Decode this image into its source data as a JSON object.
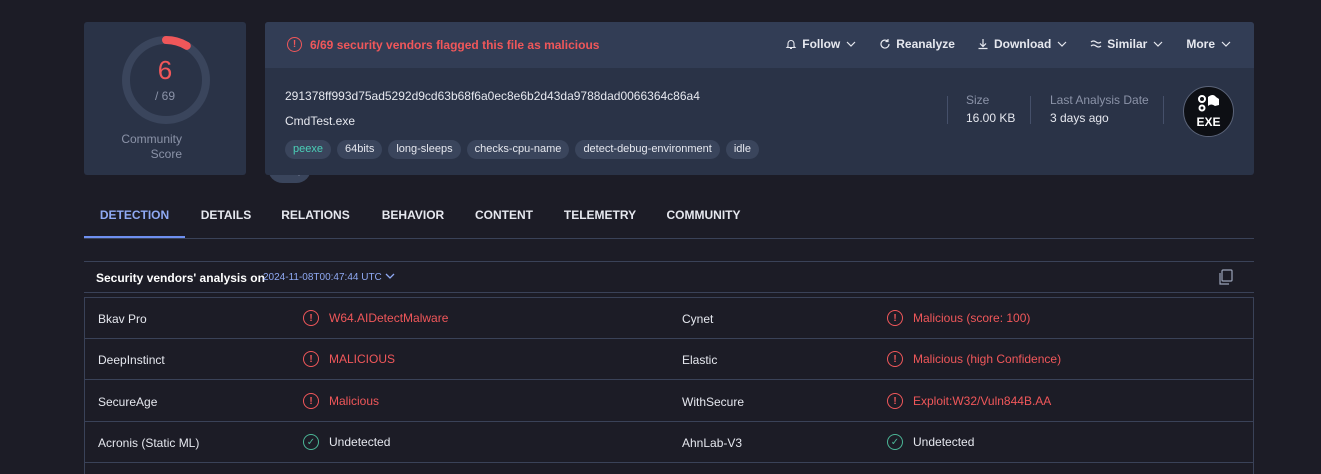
{
  "score": {
    "detected": "6",
    "total": "/ 69",
    "community_label_1": "Community",
    "community_label_2": "Score",
    "ring_color": "#f0575a",
    "detected_fraction": 0.087
  },
  "header": {
    "alert_text": "6/69 security vendors flagged this file as malicious",
    "actions": {
      "follow": "Follow",
      "reanalyze": "Reanalyze",
      "download": "Download",
      "similar": "Similar",
      "more": "More"
    }
  },
  "file": {
    "hash": "291378ff993d75ad5292d9cd63b68f6a0ec8e6b2d43da9788dad0066364c86a4",
    "name": "CmdTest.exe",
    "tags": [
      "peexe",
      "64bits",
      "long-sleeps",
      "checks-cpu-name",
      "detect-debug-environment",
      "idle"
    ],
    "size_label": "Size",
    "size_value": "16.00 KB",
    "last_analysis_label": "Last Analysis Date",
    "last_analysis_value": "3 days ago",
    "type_badge": "EXE"
  },
  "tabs": [
    "DETECTION",
    "DETAILS",
    "RELATIONS",
    "BEHAVIOR",
    "CONTENT",
    "TELEMETRY",
    "COMMUNITY"
  ],
  "analysis": {
    "title": "Security vendors' analysis on",
    "date": "2024-11-08T00:47:44 UTC"
  },
  "vendors": [
    {
      "left_name": "Bkav Pro",
      "left_result": "W64.AIDetectMalware",
      "left_status": "malicious",
      "right_name": "Cynet",
      "right_result": "Malicious (score: 100)",
      "right_status": "malicious"
    },
    {
      "left_name": "DeepInstinct",
      "left_result": "MALICIOUS",
      "left_status": "malicious",
      "right_name": "Elastic",
      "right_result": "Malicious (high Confidence)",
      "right_status": "malicious"
    },
    {
      "left_name": "SecureAge",
      "left_result": "Malicious",
      "left_status": "malicious",
      "right_name": "WithSecure",
      "right_result": "Exploit:W32/Vuln844B.AA",
      "right_status": "malicious"
    },
    {
      "left_name": "Acronis (Static ML)",
      "left_result": "Undetected",
      "left_status": "undetected",
      "right_name": "AhnLab-V3",
      "right_result": "Undetected",
      "right_status": "undetected"
    }
  ]
}
